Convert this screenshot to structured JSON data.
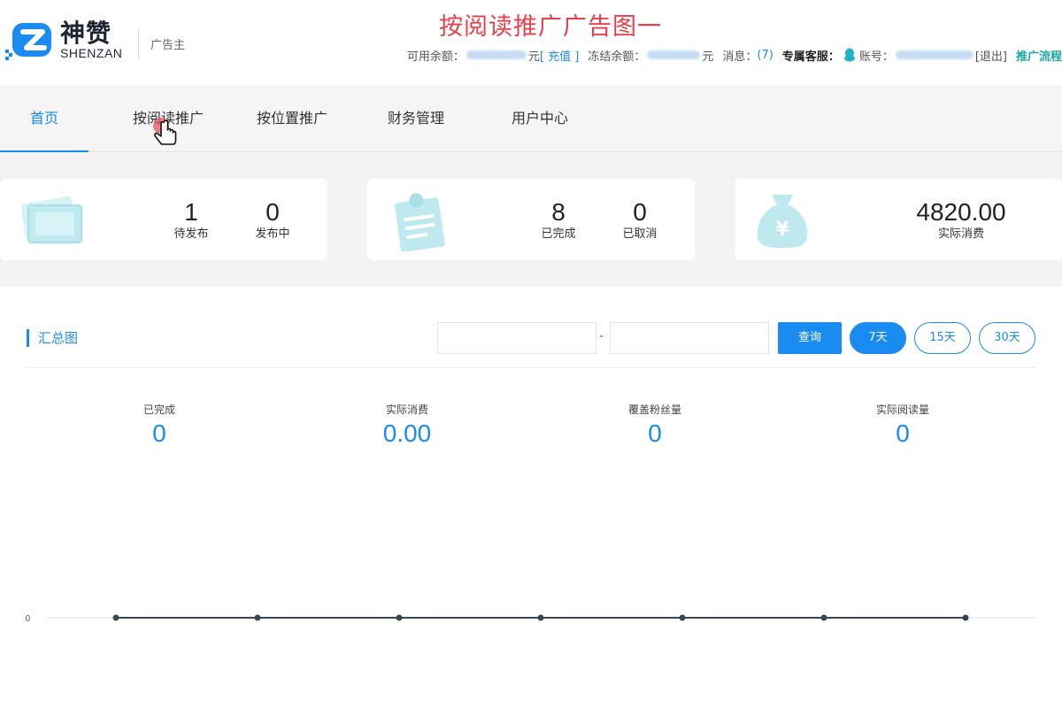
{
  "brand": {
    "name_cn": "神赞",
    "name_en": "SHENZAN",
    "role": "广告主"
  },
  "overlay_title": "按阅读推广广告图一",
  "account_bar": {
    "available_label": "可用余额：",
    "yuan1": "元",
    "recharge": "[ 充值 ]",
    "frozen_label": "冻结余额：",
    "yuan2": "元",
    "messages_label": "消息：",
    "messages_count": "(7)",
    "service_label": "专属客服：",
    "account_label": "账号：",
    "logout": "[退出]",
    "promo_flow": "推广流程"
  },
  "nav": {
    "items": [
      {
        "label": "首页",
        "active": true
      },
      {
        "label": "按阅读推广"
      },
      {
        "label": "按位置推广"
      },
      {
        "label": "财务管理"
      },
      {
        "label": "用户中心"
      }
    ]
  },
  "stats": {
    "card1": {
      "items": [
        {
          "value": "1",
          "label": "待发布"
        },
        {
          "value": "0",
          "label": "发布中"
        }
      ]
    },
    "card2": {
      "items": [
        {
          "value": "8",
          "label": "已完成"
        },
        {
          "value": "0",
          "label": "已取消"
        }
      ]
    },
    "card3": {
      "items": [
        {
          "value": "4820.00",
          "label": "实际消费"
        }
      ]
    }
  },
  "summary": {
    "title": "汇总图",
    "date_separator": "-",
    "query_label": "查询",
    "ranges": [
      {
        "label": "7天",
        "active": true
      },
      {
        "label": "15天"
      },
      {
        "label": "30天"
      }
    ],
    "metrics": [
      {
        "label": "已完成",
        "value": "0"
      },
      {
        "label": "实际消费",
        "value": "0.00"
      },
      {
        "label": "覆盖粉丝量",
        "value": "0"
      },
      {
        "label": "实际阅读量",
        "value": "0"
      }
    ]
  },
  "colors": {
    "accent": "#1a8bf0",
    "overlay_title": "#e8404a",
    "icon_tint": "#bde9ef",
    "line": "#3a4554"
  },
  "chart_data": {
    "type": "line",
    "categories": [
      "",
      "",
      "",
      "",
      "",
      "",
      ""
    ],
    "series": [
      {
        "values": [
          0,
          0,
          0,
          0,
          0,
          0,
          0
        ]
      }
    ],
    "y_tick_labels": [
      "0"
    ],
    "title": "",
    "xlabel": "",
    "ylabel": "",
    "grid": true
  }
}
